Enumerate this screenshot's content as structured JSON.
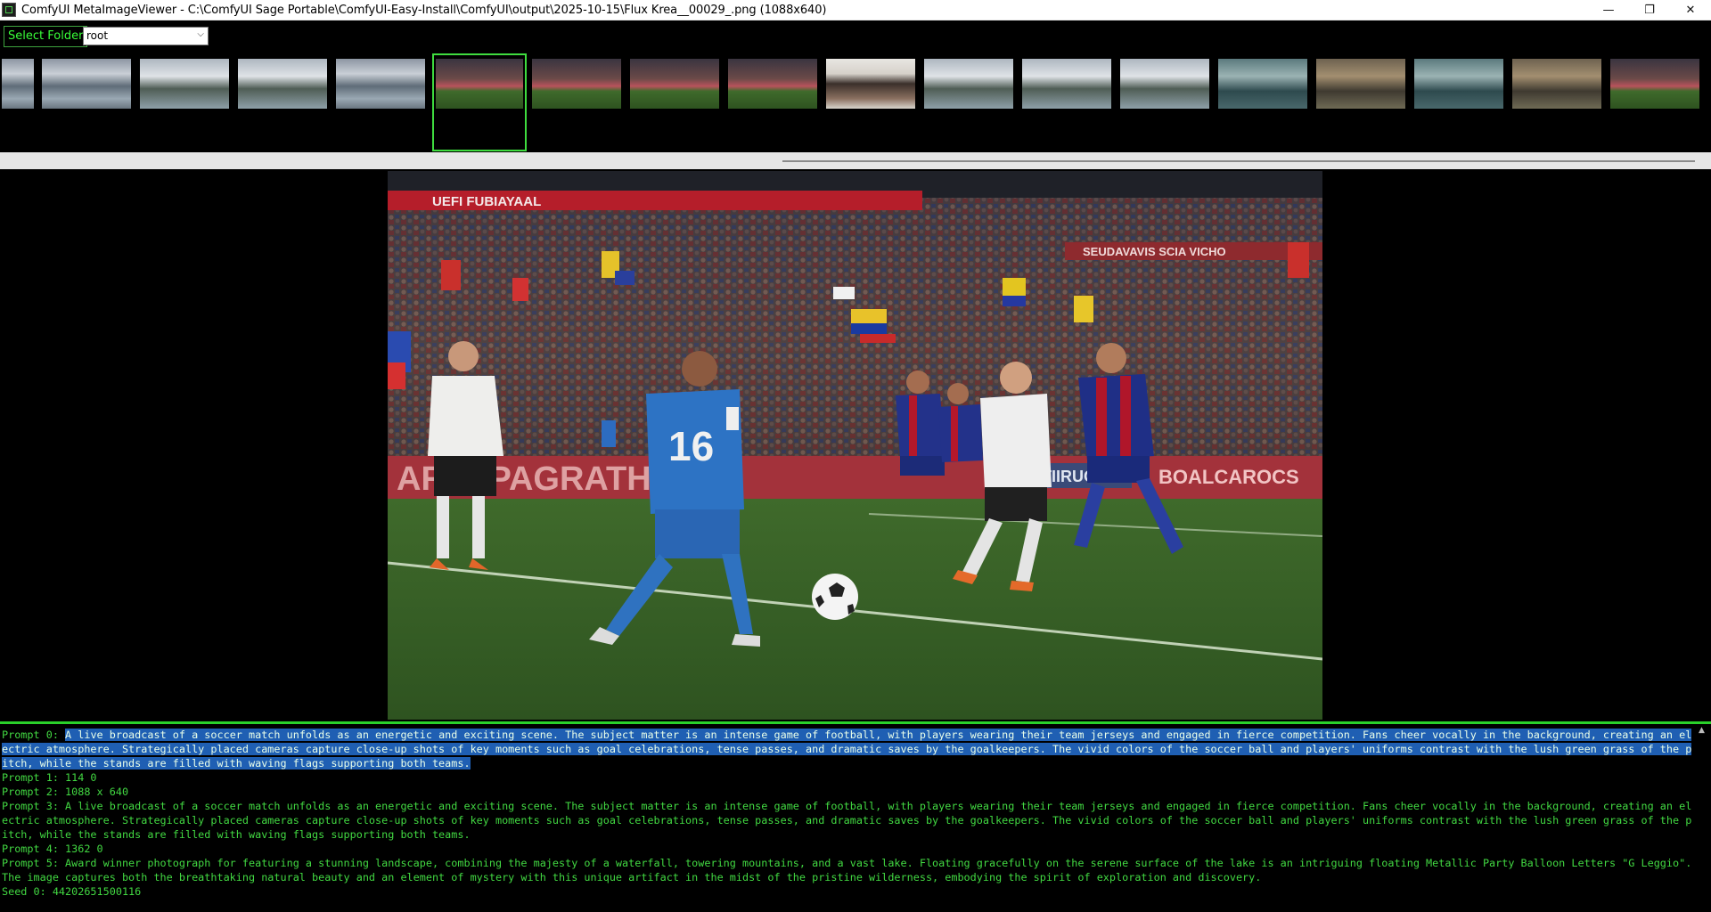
{
  "window": {
    "title": "ComfyUI MetaImageViewer - C:\\ComfyUI Sage Portable\\ComfyUI-Easy-Install\\ComfyUI\\output\\2025-10-15\\Flux Krea__00029_.png (1088x640)",
    "minimize": "—",
    "maximize": "❐",
    "close": "✕"
  },
  "toolbar": {
    "select_folder_label": "Select Folder",
    "folder_value": "root"
  },
  "thumbnails": [
    {
      "name": "thumb-01",
      "kind": "waterfall-letters"
    },
    {
      "name": "thumb-02",
      "kind": "waterfall-letters"
    },
    {
      "name": "thumb-03",
      "kind": "waterfall"
    },
    {
      "name": "thumb-04",
      "kind": "waterfall"
    },
    {
      "name": "thumb-05",
      "kind": "waterfall-letters"
    },
    {
      "name": "thumb-06",
      "kind": "soccer",
      "selected": true
    },
    {
      "name": "thumb-07",
      "kind": "soccer"
    },
    {
      "name": "thumb-08",
      "kind": "soccer"
    },
    {
      "name": "thumb-09",
      "kind": "soccer"
    },
    {
      "name": "thumb-10",
      "kind": "people"
    },
    {
      "name": "thumb-11",
      "kind": "waterfall"
    },
    {
      "name": "thumb-12",
      "kind": "waterfall"
    },
    {
      "name": "thumb-13",
      "kind": "waterfall"
    },
    {
      "name": "thumb-14",
      "kind": "lake-letters"
    },
    {
      "name": "thumb-15",
      "kind": "canyon-letters"
    },
    {
      "name": "thumb-16",
      "kind": "lake-letters"
    },
    {
      "name": "thumb-17",
      "kind": "canyon-letters"
    },
    {
      "name": "thumb-18",
      "kind": "soccer"
    }
  ],
  "main_image": {
    "stadium_banner_1": "UEFI FUBIAYAAL",
    "stadium_banner_2": "SEUDAVAVIS SCIA VICHO",
    "pitch_banner": "ARELPAGRATHRAYS",
    "pitch_banner_2": "STIIRUOS",
    "pitch_banner_3": "BOALCAROCS",
    "player_number": "16"
  },
  "metadata": {
    "p0_label": "Prompt 0: ",
    "p0_text": "A live broadcast of a soccer match unfolds as an energetic and exciting scene. The subject matter is an intense game of football, with players wearing their team jerseys and engaged in fierce competition. Fans cheer vocally in the background, creating an electric atmosphere. Strategically placed cameras capture close-up shots of key moments such as goal celebrations, tense passes, and dramatic saves by the goalkeepers. The vivid colors of the soccer ball and players' uniforms contrast with the lush green grass of the pitch, while the stands are filled with waving flags supporting both teams.",
    "p1": "Prompt 1: 114 0",
    "p2": "Prompt 2: 1088 x 640",
    "p3": "Prompt 3: A live broadcast of a soccer match unfolds as an energetic and exciting scene. The subject matter is an intense game of football, with players wearing their team jerseys and engaged in fierce competition. Fans cheer vocally in the background, creating an electric atmosphere. Strategically placed cameras capture close-up shots of key moments such as goal celebrations, tense passes, and dramatic saves by the goalkeepers. The vivid colors of the soccer ball and players' uniforms contrast with the lush green grass of the pitch, while the stands are filled with waving flags supporting both teams.",
    "p4": "Prompt 4: 1362 0",
    "p5": "Prompt 5: Award winner photograph for featuring a stunning landscape, combining the majesty of a waterfall, towering mountains, and a vast lake. Floating gracefully on the serene surface of the lake is an intriguing floating Metallic Party Balloon Letters \"G Leggio\". The image captures both the breathtaking natural beauty and an element of mystery with this unique artifact in the midst of the pristine wilderness, embodying the spirit of exploration and discovery.",
    "seed": "Seed 0: 44202651500116"
  }
}
